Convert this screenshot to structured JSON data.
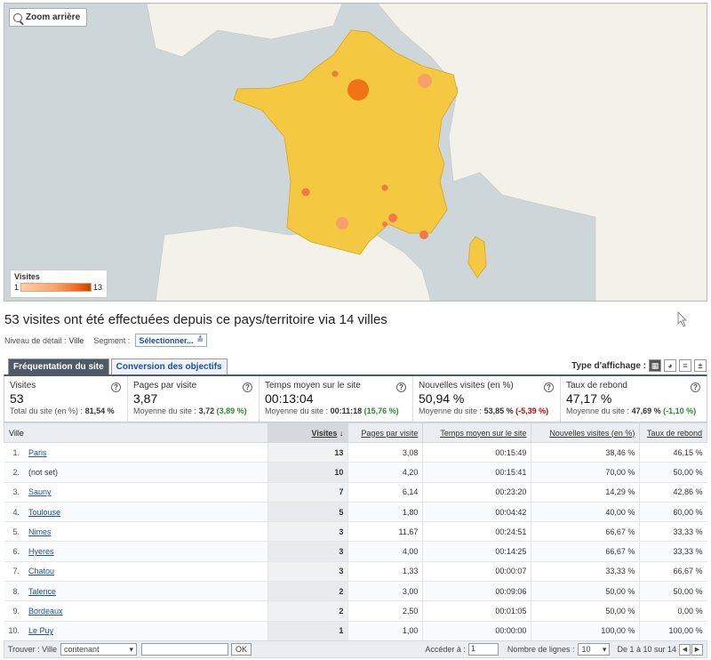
{
  "map": {
    "zoom_label": "Zoom arrière",
    "legend_title": "Visites",
    "legend_min": "1",
    "legend_max": "13",
    "colors": {
      "sea": "#cdd6d9",
      "land": "#f2f2ea",
      "country": "#f5c842",
      "bubble": "#f08040"
    }
  },
  "heading": {
    "title": "53 visites ont été effectuées depuis ce pays/territoire via 14 villes",
    "level_label": "Niveau de détail :",
    "level_value": "Ville",
    "segment_label": "Segment :",
    "segment_value": "Sélectionner..."
  },
  "tabs": [
    {
      "label": "Fréquentation du site",
      "active": true
    },
    {
      "label": "Conversion des objectifs",
      "active": false
    }
  ],
  "view_type_label": "Type d'affichage :",
  "summary": [
    {
      "label": "Visites",
      "value": "53",
      "sub_label": "Total du site (en %) :",
      "sub_value": "81,54 %",
      "delta": "",
      "delta_class": ""
    },
    {
      "label": "Pages par visite",
      "value": "3,87",
      "sub_label": "Moyenne du site :",
      "sub_value": "3,72",
      "delta": "(3,89 %)",
      "delta_class": "pos"
    },
    {
      "label": "Temps moyen sur le site",
      "value": "00:13:04",
      "sub_label": "Moyenne du site :",
      "sub_value": "00:11:18",
      "delta": "(15,76 %)",
      "delta_class": "pos"
    },
    {
      "label": "Nouvelles visites (en %)",
      "value": "50,94 %",
      "sub_label": "Moyenne du site :",
      "sub_value": "53,85 %",
      "delta": "(-5,39 %)",
      "delta_class": "neg"
    },
    {
      "label": "Taux de rebond",
      "value": "47,17 %",
      "sub_label": "Moyenne du site :",
      "sub_value": "47,69 %",
      "delta": "(-1,10 %)",
      "delta_class": "pos"
    }
  ],
  "table": {
    "columns": [
      "Ville",
      "Visites",
      "Pages par visite",
      "Temps moyen sur le site",
      "Nouvelles visites (en %)",
      "Taux de rebond"
    ],
    "rows": [
      {
        "n": "1.",
        "city": "Paris",
        "link": true,
        "visits": "13",
        "pages": "3,08",
        "time": "00:15:49",
        "new": "38,46 %",
        "bounce": "46,15 %"
      },
      {
        "n": "2.",
        "city": "(not set)",
        "link": false,
        "visits": "10",
        "pages": "4,20",
        "time": "00:15:41",
        "new": "70,00 %",
        "bounce": "50,00 %"
      },
      {
        "n": "3.",
        "city": "Sauny",
        "link": true,
        "visits": "7",
        "pages": "6,14",
        "time": "00:23:20",
        "new": "14,29 %",
        "bounce": "42,86 %"
      },
      {
        "n": "4.",
        "city": "Toulouse",
        "link": true,
        "visits": "5",
        "pages": "1,80",
        "time": "00:04:42",
        "new": "40,00 %",
        "bounce": "60,00 %"
      },
      {
        "n": "5.",
        "city": "Nimes",
        "link": true,
        "visits": "3",
        "pages": "11,67",
        "time": "00:24:51",
        "new": "66,67 %",
        "bounce": "33,33 %"
      },
      {
        "n": "6.",
        "city": "Hyeres",
        "link": true,
        "visits": "3",
        "pages": "4,00",
        "time": "00:14:25",
        "new": "66,67 %",
        "bounce": "33,33 %"
      },
      {
        "n": "7.",
        "city": "Chatou",
        "link": true,
        "visits": "3",
        "pages": "1,33",
        "time": "00:00:07",
        "new": "33,33 %",
        "bounce": "66,67 %"
      },
      {
        "n": "8.",
        "city": "Talence",
        "link": true,
        "visits": "2",
        "pages": "3,00",
        "time": "00:09:06",
        "new": "50,00 %",
        "bounce": "50,00 %"
      },
      {
        "n": "9.",
        "city": "Bordeaux",
        "link": true,
        "visits": "2",
        "pages": "2,50",
        "time": "00:01:05",
        "new": "50,00 %",
        "bounce": "0,00 %"
      },
      {
        "n": "10.",
        "city": "Le Puy",
        "link": true,
        "visits": "1",
        "pages": "1,00",
        "time": "00:00:00",
        "new": "100,00 %",
        "bounce": "100,00 %"
      }
    ]
  },
  "footer": {
    "find_label": "Trouver : Ville",
    "match_option": "contenant",
    "ok_label": "OK",
    "goto_label": "Accéder à :",
    "goto_value": "1",
    "rows_label": "Nombre de lignes :",
    "rows_value": "10",
    "range_label": "De 1 à 10 sur 14"
  }
}
